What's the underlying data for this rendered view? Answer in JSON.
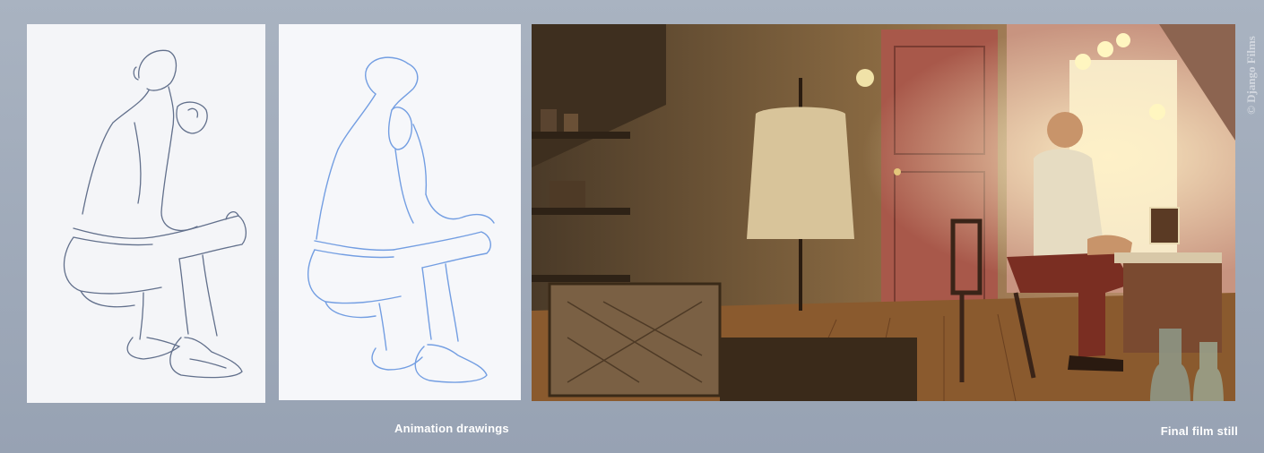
{
  "captions": {
    "drawings": "Animation drawings",
    "still": "Final film still"
  },
  "credit": "© Django Films",
  "colors": {
    "background": "#a2acbb",
    "pencil_dark": "#5a6a86",
    "pencil_blue": "#6f9be0",
    "caption": "#ffffff"
  }
}
